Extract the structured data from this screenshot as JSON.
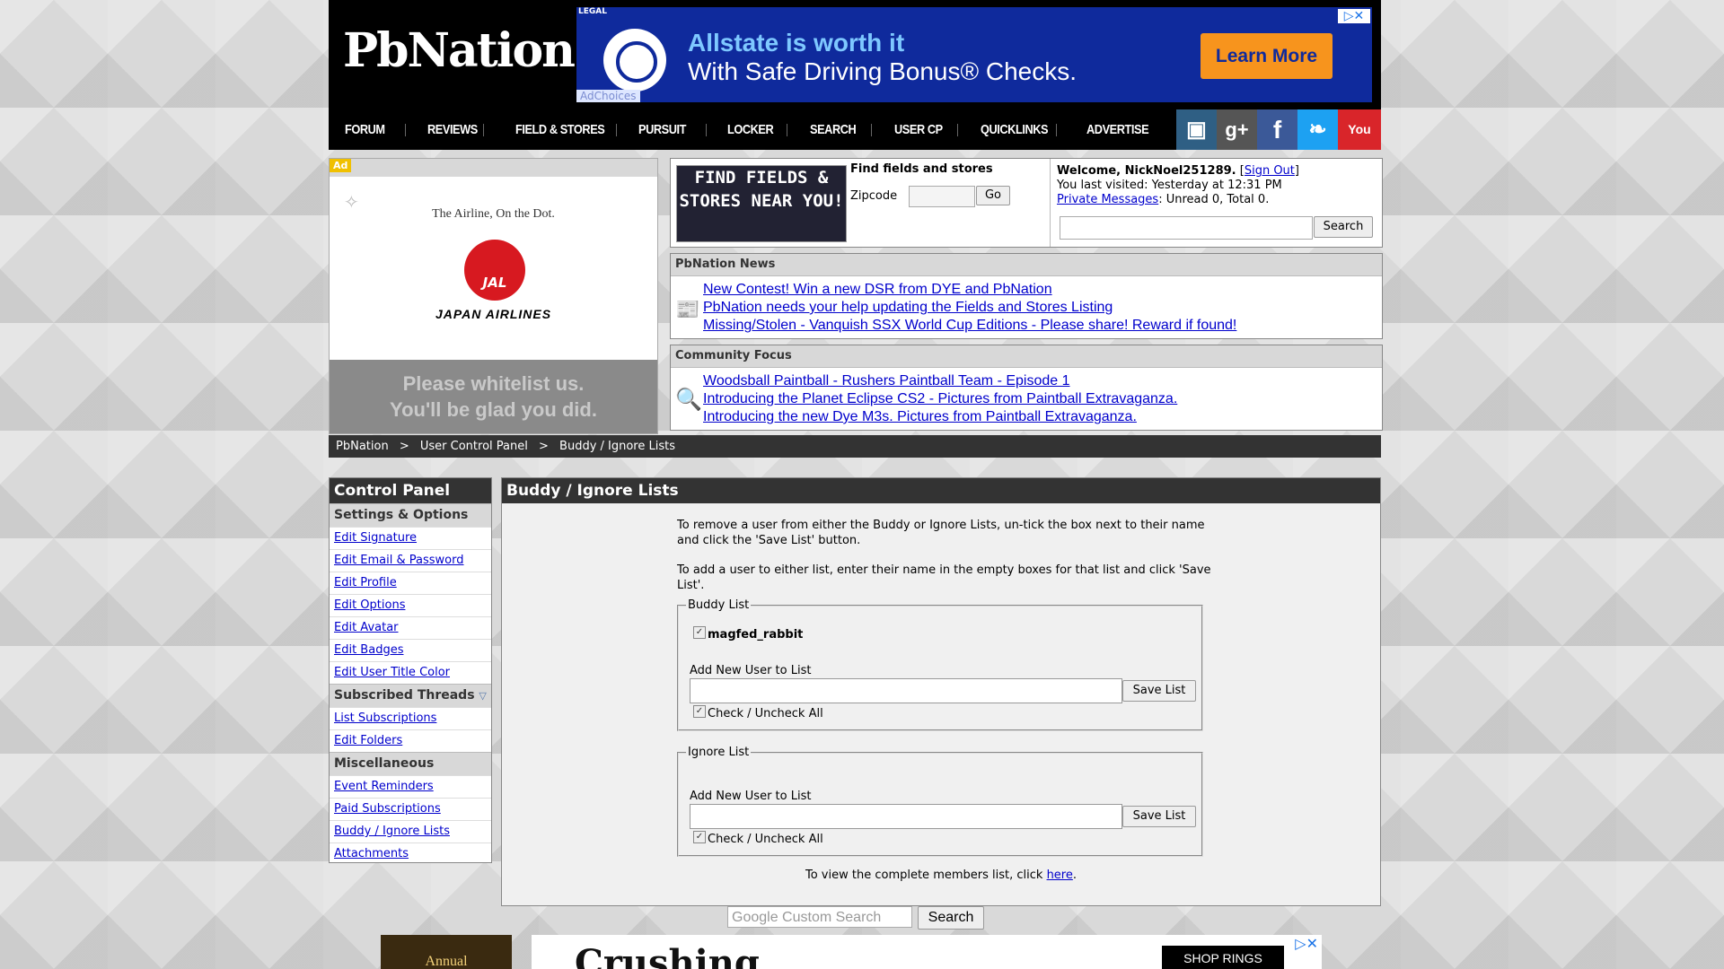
{
  "site": {
    "logo": "PbNation"
  },
  "top_ad": {
    "legal": "LEGAL",
    "headline": "Allstate is worth it",
    "subline": "With Safe Driving Bonus® Checks.",
    "cta": "Learn More",
    "adchoices": "AdChoices",
    "icons": [
      "adchoices-icon",
      "close-icon"
    ]
  },
  "nav": [
    {
      "label": "FORUM"
    },
    {
      "label": "REVIEWS"
    },
    {
      "label": "FIELD & STORES"
    },
    {
      "label": "PURSUIT"
    },
    {
      "label": "LOCKER"
    },
    {
      "label": "SEARCH"
    },
    {
      "label": "USER CP"
    },
    {
      "label": "QUICKLINKS"
    },
    {
      "label": "ADVERTISE"
    }
  ],
  "social": [
    {
      "icon": "instagram-icon",
      "glyph": "▣",
      "color": "#2f5f84"
    },
    {
      "icon": "google-plus-icon",
      "glyph": "g+",
      "color": "#555555"
    },
    {
      "icon": "facebook-icon",
      "glyph": "f",
      "color": "#3b5998"
    },
    {
      "icon": "twitter-icon",
      "glyph": "❧",
      "color": "#1da1f2"
    },
    {
      "icon": "youtube-icon",
      "glyph": "You",
      "color": "#d9252a"
    }
  ],
  "left_ad": {
    "tag": "Ad",
    "tagline": "The Airline, On the Dot.",
    "logo_text": "JAL",
    "brand": "JAPAN AIRLINES",
    "whitelist_line1": "Please whitelist us.",
    "whitelist_line2": "You'll be glad you did."
  },
  "find": {
    "image_text": "FIND FIELDS & STORES NEAR YOU!",
    "title": "Find fields and stores",
    "zip_label": "Zipcode",
    "zip_value": "",
    "go": "Go"
  },
  "welcome": {
    "greeting": "Welcome, NickNoel251289.",
    "signout": "Sign Out",
    "last_visit": "You last visited: Yesterday at 12:31 PM",
    "pm_link": "Private Messages",
    "pm_status": ": Unread 0, Total 0.",
    "search_value": "",
    "search_button": "Search"
  },
  "news": {
    "title": "PbNation News",
    "items": [
      "New Contest! Win a new DSR from DYE and PbNation",
      "PbNation needs your help updating the Fields and Stores Listing",
      "Missing/Stolen - Vanquish SSX World Cup Editions - Please share! Reward if found!"
    ]
  },
  "focus": {
    "title": "Community Focus",
    "items": [
      "Woodsball Paintball - Rushers Paintball Team - Episode 1",
      "Introducing the Planet Eclipse CS2 - Pictures from Paintball Extravaganza.",
      "Introducing the new Dye M3s. Pictures from Paintball Extravaganza."
    ]
  },
  "breadcrumb": [
    "PbNation",
    ">",
    "User Control Panel",
    ">",
    "Buddy / Ignore Lists"
  ],
  "control_panel": {
    "title": "Control Panel",
    "sections": [
      {
        "title": "Settings & Options",
        "items": [
          "Edit Signature",
          "Edit Email & Password",
          "Edit Profile",
          "Edit Options",
          "Edit Avatar",
          "Edit Badges",
          "Edit User Title Color"
        ]
      },
      {
        "title": "Subscribed Threads",
        "items": [
          "List Subscriptions",
          "Edit Folders"
        ]
      },
      {
        "title": "Miscellaneous",
        "items": [
          "Event Reminders",
          "Paid Subscriptions",
          "Buddy / Ignore Lists",
          "Attachments"
        ]
      }
    ]
  },
  "main": {
    "title": "Buddy / Ignore Lists",
    "intro1": "To remove a user from either the Buddy or Ignore Lists, un-tick the box next to their name and click the 'Save List' button.",
    "intro2": "To add a user to either list, enter their name in the empty boxes for that list and click 'Save List'.",
    "buddy": {
      "legend": "Buddy List",
      "members": [
        {
          "name": "magfed_rabbit",
          "checked": true
        }
      ],
      "add_label": "Add New User to List",
      "input_value": "",
      "save": "Save List",
      "check_all": "Check / Uncheck All"
    },
    "ignore": {
      "legend": "Ignore List",
      "add_label": "Add New User to List",
      "input_value": "",
      "save": "Save List",
      "check_all": "Check / Uncheck All"
    },
    "footnote_pre": "To view the complete members list, click ",
    "footnote_link": "here",
    "footnote_post": "."
  },
  "bottom": {
    "search_placeholder": "Google  Custom Search",
    "search_button": "Search",
    "ad1_text": "Annual",
    "ad2_headline": "Crushing",
    "ad2_cta": "SHOP RINGS"
  }
}
